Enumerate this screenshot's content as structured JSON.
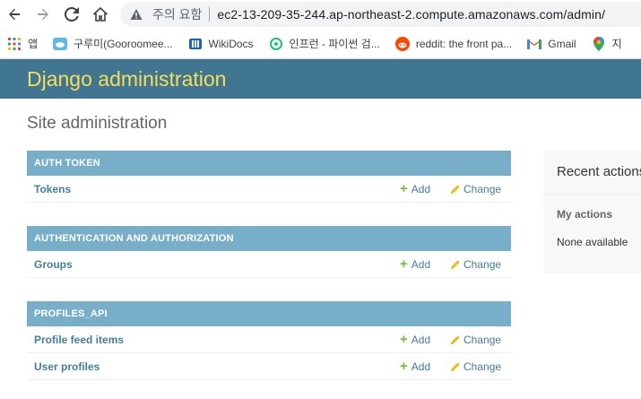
{
  "browser": {
    "security_label": "주의 요함",
    "url": "ec2-13-209-35-244.ap-northeast-2.compute.amazonaws.com/admin/",
    "bookmarks": [
      {
        "label": "앱"
      },
      {
        "label": "구루미(Gooroomee..."
      },
      {
        "label": "WikiDocs"
      },
      {
        "label": "인프런 - 파이썬 검..."
      },
      {
        "label": "reddit: the front pa..."
      },
      {
        "label": "Gmail"
      },
      {
        "label": "지"
      }
    ]
  },
  "header": {
    "brand": "Django administration"
  },
  "page": {
    "title": "Site administration"
  },
  "modules": [
    {
      "caption": "AUTH TOKEN",
      "models": [
        {
          "name": "Tokens",
          "add": "Add",
          "change": "Change"
        }
      ]
    },
    {
      "caption": "AUTHENTICATION AND AUTHORIZATION",
      "models": [
        {
          "name": "Groups",
          "add": "Add",
          "change": "Change"
        }
      ]
    },
    {
      "caption": "PROFILES_API",
      "models": [
        {
          "name": "Profile feed items",
          "add": "Add",
          "change": "Change"
        },
        {
          "name": "User profiles",
          "add": "Add",
          "change": "Change"
        }
      ]
    }
  ],
  "recent_actions": {
    "title": "Recent actions",
    "my_actions": "My actions",
    "empty": "None available"
  },
  "colors": {
    "header_bg": "#417690",
    "brand": "#f5dd5d",
    "caption_bg": "#79aec8",
    "link": "#447e9b",
    "add_plus": "#70bf2b"
  }
}
